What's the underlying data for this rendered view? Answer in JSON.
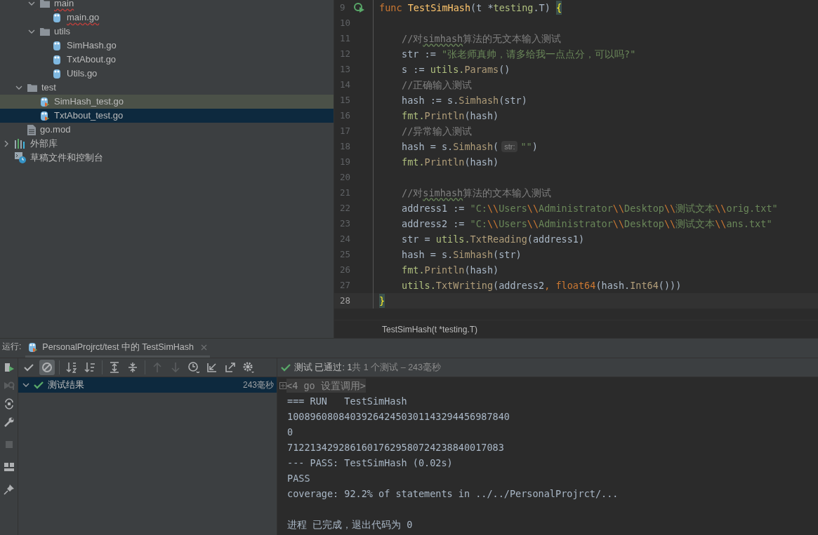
{
  "project_tree": [
    {
      "children": [
        {
          "children": [
            {
              "label": "main",
              "kind": "folder",
              "expanded": true,
              "error": true,
              "children": [
                {
                  "label": "main.go",
                  "kind": "go",
                  "error": true
                }
              ]
            },
            {
              "label": "utils",
              "kind": "folder",
              "expanded": true,
              "children": [
                {
                  "label": "SimHash.go",
                  "kind": "go"
                },
                {
                  "label": "TxtAbout.go",
                  "kind": "go"
                },
                {
                  "label": "Utils.go",
                  "kind": "go"
                }
              ]
            }
          ]
        },
        {
          "label": "test",
          "kind": "folder",
          "expanded": true,
          "children": [
            {
              "label": "SimHash_test.go",
              "kind": "go_test",
              "active_file": true,
              "selected": false
            },
            {
              "label": "TxtAbout_test.go",
              "kind": "go_test",
              "active_file": false,
              "selected": true
            }
          ]
        },
        {
          "label": "go.mod",
          "kind": "mod"
        }
      ]
    },
    {
      "label": "外部库",
      "kind": "library",
      "expanded": false
    },
    {
      "label": "草稿文件和控制台",
      "kind": "scratches"
    }
  ],
  "editor": {
    "lines": [
      {
        "number": "9",
        "run_marker": true,
        "current": false,
        "indent": false,
        "tokens": [
          {
            "text": "func ",
            "kind": "kw"
          },
          {
            "text": "TestSimHash",
            "kind": "decl"
          },
          {
            "text": "(t *",
            "kind": "text"
          },
          {
            "text": "testing",
            "kind": "pkg"
          },
          {
            "text": ".T) ",
            "kind": "text"
          },
          {
            "text": "{",
            "kind": "brace"
          }
        ]
      },
      {
        "number": "10",
        "run_marker": false,
        "current": false,
        "indent": false
      },
      {
        "number": "11",
        "run_marker": false,
        "current": false,
        "indent": true,
        "tokens": [
          {
            "text": "//对",
            "kind": "comment"
          },
          {
            "text": "simhash",
            "kind": "comment_typo"
          },
          {
            "text": "算法的无文本输入测试",
            "kind": "comment"
          }
        ]
      },
      {
        "number": "12",
        "run_marker": false,
        "current": false,
        "indent": true,
        "tokens": [
          {
            "text": "str := ",
            "kind": "text"
          },
          {
            "text": "\"张老师真帅，请多给我一点点分，可以吗?\"",
            "kind": "str"
          }
        ]
      },
      {
        "number": "13",
        "run_marker": false,
        "current": false,
        "indent": true,
        "tokens": [
          {
            "text": "s := ",
            "kind": "text"
          },
          {
            "text": "utils.",
            "kind": "pkg"
          },
          {
            "text": "Params",
            "kind": "call"
          },
          {
            "text": "()",
            "kind": "text"
          }
        ]
      },
      {
        "number": "14",
        "run_marker": false,
        "current": false,
        "indent": true,
        "tokens": [
          {
            "text": "//正确输入测试",
            "kind": "comment"
          }
        ]
      },
      {
        "number": "15",
        "run_marker": false,
        "current": false,
        "indent": true,
        "tokens": [
          {
            "text": "hash := s.",
            "kind": "text"
          },
          {
            "text": "Simhash",
            "kind": "call"
          },
          {
            "text": "(str)",
            "kind": "text"
          }
        ]
      },
      {
        "number": "16",
        "run_marker": false,
        "current": false,
        "indent": true,
        "tokens": [
          {
            "text": "fmt.",
            "kind": "pkg"
          },
          {
            "text": "Println",
            "kind": "call"
          },
          {
            "text": "(hash)",
            "kind": "text"
          }
        ]
      },
      {
        "number": "17",
        "run_marker": false,
        "current": false,
        "indent": true,
        "tokens": [
          {
            "text": "//异常输入测试",
            "kind": "comment"
          }
        ]
      },
      {
        "number": "18",
        "run_marker": false,
        "current": false,
        "indent": true,
        "tokens": [
          {
            "text": "hash = s.",
            "kind": "text"
          },
          {
            "text": "Simhash",
            "kind": "call"
          },
          {
            "text": "(",
            "kind": "text"
          },
          {
            "text": "str:",
            "kind": "hint"
          },
          {
            "text": "\"\"",
            "kind": "str"
          },
          {
            "text": ")",
            "kind": "text"
          }
        ]
      },
      {
        "number": "19",
        "run_marker": false,
        "current": false,
        "indent": true,
        "tokens": [
          {
            "text": "fmt.",
            "kind": "pkg"
          },
          {
            "text": "Println",
            "kind": "call"
          },
          {
            "text": "(hash)",
            "kind": "text"
          }
        ]
      },
      {
        "number": "20",
        "run_marker": false,
        "current": false,
        "indent": false
      },
      {
        "number": "21",
        "run_marker": false,
        "current": false,
        "indent": true,
        "tokens": [
          {
            "text": "//对",
            "kind": "comment"
          },
          {
            "text": "simhash",
            "kind": "comment_typo"
          },
          {
            "text": "算法的文本输入测试",
            "kind": "comment"
          }
        ]
      },
      {
        "number": "22",
        "run_marker": false,
        "current": false,
        "indent": true,
        "tokens": [
          {
            "text": "address1 := ",
            "kind": "text"
          },
          {
            "text": "\"C:",
            "kind": "str"
          },
          {
            "text": "\\\\",
            "kind": "esc"
          },
          {
            "text": "Users",
            "kind": "str"
          },
          {
            "text": "\\\\",
            "kind": "esc"
          },
          {
            "text": "Administrator",
            "kind": "str"
          },
          {
            "text": "\\\\",
            "kind": "esc"
          },
          {
            "text": "Desktop",
            "kind": "str"
          },
          {
            "text": "\\\\",
            "kind": "esc"
          },
          {
            "text": "测试文本",
            "kind": "str"
          },
          {
            "text": "\\\\",
            "kind": "esc"
          },
          {
            "text": "orig.txt\"",
            "kind": "str"
          }
        ]
      },
      {
        "number": "23",
        "run_marker": false,
        "current": false,
        "indent": true,
        "tokens": [
          {
            "text": "address2 := ",
            "kind": "text"
          },
          {
            "text": "\"C:",
            "kind": "str"
          },
          {
            "text": "\\\\",
            "kind": "esc"
          },
          {
            "text": "Users",
            "kind": "str"
          },
          {
            "text": "\\\\",
            "kind": "esc"
          },
          {
            "text": "Administrator",
            "kind": "str"
          },
          {
            "text": "\\\\",
            "kind": "esc"
          },
          {
            "text": "Desktop",
            "kind": "str"
          },
          {
            "text": "\\\\",
            "kind": "esc"
          },
          {
            "text": "测试文本",
            "kind": "str"
          },
          {
            "text": "\\\\",
            "kind": "esc"
          },
          {
            "text": "ans.txt\"",
            "kind": "str"
          }
        ]
      },
      {
        "number": "24",
        "run_marker": false,
        "current": false,
        "indent": true,
        "tokens": [
          {
            "text": "str = ",
            "kind": "text"
          },
          {
            "text": "utils.",
            "kind": "pkg"
          },
          {
            "text": "TxtReading",
            "kind": "call"
          },
          {
            "text": "(address1)",
            "kind": "text"
          }
        ]
      },
      {
        "number": "25",
        "run_marker": false,
        "current": false,
        "indent": true,
        "tokens": [
          {
            "text": "hash = s.",
            "kind": "text"
          },
          {
            "text": "Simhash",
            "kind": "call"
          },
          {
            "text": "(str)",
            "kind": "text"
          }
        ]
      },
      {
        "number": "26",
        "run_marker": false,
        "current": false,
        "indent": true,
        "tokens": [
          {
            "text": "fmt.",
            "kind": "pkg"
          },
          {
            "text": "Println",
            "kind": "call"
          },
          {
            "text": "(hash)",
            "kind": "text"
          }
        ]
      },
      {
        "number": "27",
        "run_marker": false,
        "current": false,
        "indent": true,
        "tokens": [
          {
            "text": "utils.",
            "kind": "pkg"
          },
          {
            "text": "TxtWriting",
            "kind": "call"
          },
          {
            "text": "(address2",
            "kind": "text"
          },
          {
            "text": ", ",
            "kind": "kw"
          },
          {
            "text": "float64",
            "kind": "kw"
          },
          {
            "text": "(hash.",
            "kind": "text"
          },
          {
            "text": "Int64",
            "kind": "call"
          },
          {
            "text": "()))",
            "kind": "text"
          }
        ]
      },
      {
        "number": "28",
        "run_marker": false,
        "current": true,
        "indent": false,
        "tokens": [
          {
            "text": "}",
            "kind": "brace"
          }
        ]
      }
    ],
    "breadcrumb": "TestSimHash(t *testing.T)"
  },
  "run_panel": {
    "label": "运行:",
    "tab": "PersonalProjrct/test 中的 TestSimHash",
    "side_tools": [
      {
        "kind": "rerun",
        "disabled": false
      },
      {
        "kind": "rerun_failed",
        "disabled": true
      },
      {
        "kind": "toggle",
        "disabled": false
      },
      {
        "kind": "wrench",
        "disabled": false
      },
      {
        "kind": "stop",
        "disabled": true
      },
      {
        "kind": "layout",
        "disabled": false
      },
      {
        "kind": "pin",
        "disabled": false
      }
    ],
    "toolbar": [
      {
        "kind": "check",
        "on": false,
        "disabled": false
      },
      {
        "kind": "ignore",
        "on": true,
        "disabled": false
      },
      {
        "kind": "sort_alpha",
        "on": false,
        "disabled": false
      },
      {
        "kind": "sort_duration",
        "on": false,
        "disabled": false
      },
      {
        "kind": "expand",
        "on": false,
        "disabled": false
      },
      {
        "kind": "collapse",
        "on": false,
        "disabled": false
      },
      {
        "kind": "up",
        "on": false,
        "disabled": true
      },
      {
        "kind": "down",
        "on": false,
        "disabled": true
      },
      {
        "kind": "history",
        "on": false,
        "disabled": false
      },
      {
        "kind": "import",
        "on": false,
        "disabled": false
      },
      {
        "kind": "export",
        "on": false,
        "disabled": false
      },
      {
        "kind": "settings",
        "on": false,
        "disabled": false
      }
    ],
    "results": [
      {
        "label": "测试结果",
        "time": "243毫秒",
        "passed": true,
        "expanded": true,
        "selected": true
      }
    ],
    "status": "**测试 已通过: 1**共 1 个测试 – 243毫秒",
    "console": [
      {
        "text": "<4 go 设置调用>",
        "kind": "folded"
      },
      {
        "text": "=== RUN   TestSimHash",
        "kind": "text"
      },
      {
        "text": "100896080840392642450301143294456987840",
        "kind": "text"
      },
      {
        "text": "0",
        "kind": "text"
      },
      {
        "text": "71221342928616017629580724238840017083",
        "kind": "text"
      },
      {
        "text": "--- PASS: TestSimHash (0.02s)",
        "kind": "text"
      },
      {
        "text": "PASS",
        "kind": "text"
      },
      {
        "text": "coverage: 92.2% of statements in ../../PersonalProjrct/...",
        "kind": "text"
      },
      {
        "kind": "blank"
      },
      {
        "text": "进程 已完成，退出代码为 0",
        "kind": "text"
      }
    ]
  }
}
